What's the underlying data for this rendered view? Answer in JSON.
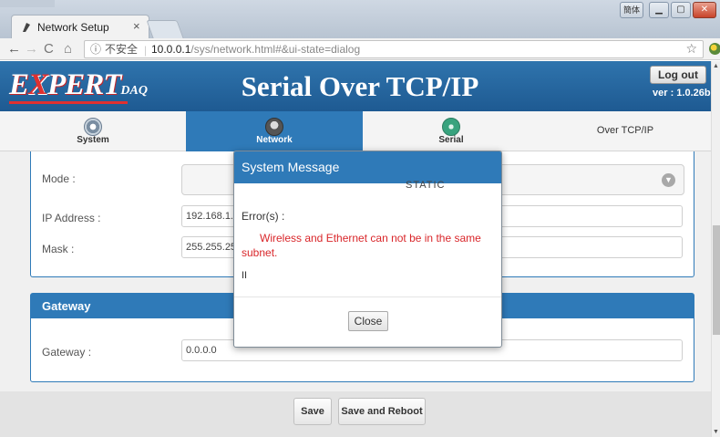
{
  "browser": {
    "tab_title": "Network Setup",
    "tab_close": "×",
    "info_icon": "ⓘ",
    "security_label": "不安全",
    "url_host": "10.0.0.1",
    "url_path": "/sys/network.html#&ui-state=dialog",
    "lang_indicator": "簡体",
    "icons": [
      "back-icon",
      "forward-icon",
      "reload-icon",
      "home-icon",
      "star-icon",
      "menu-icon"
    ]
  },
  "header": {
    "brand_ex": "E",
    "brand_x": "X",
    "brand_pert": "PERT",
    "brand_daq": "DAQ",
    "title": "Serial Over TCP/IP",
    "logout_label": "Log out",
    "version": "ver : 1.0.26b"
  },
  "nav": {
    "tabs": [
      {
        "label": "System",
        "icon": "system-icon"
      },
      {
        "label": "Network",
        "icon": "network-icon",
        "active": true
      },
      {
        "label": "Serial",
        "icon": "serial-icon"
      },
      {
        "label": "Over TCP/IP"
      }
    ]
  },
  "form": {
    "mode_label": "Mode :",
    "ip_label": "IP Address :",
    "ip_value": "192.168.1.1",
    "mask_label": "Mask :",
    "mask_value": "255.255.255.0",
    "gateway_header": "Gateway",
    "gateway_label": "Gateway :",
    "gateway_value": "0.0.0.0"
  },
  "footer": {
    "save_label": "Save",
    "save_reboot_label": "Save and Reboot"
  },
  "modal": {
    "title": "System Message",
    "ghost_text": "STATIC",
    "errors_label": "Error(s) :",
    "message": "Wireless and Ethernet can not be in the same subnet.",
    "mark": "II",
    "close_label": "Close"
  },
  "colors": {
    "accent": "#2f7ab8",
    "error": "#d9262a",
    "brand_red": "#e03030"
  }
}
